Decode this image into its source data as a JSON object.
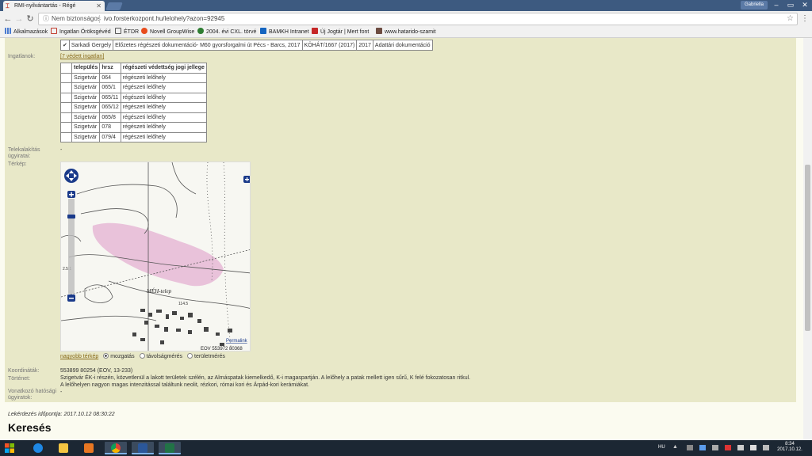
{
  "browser": {
    "tab_title": "RMI-nyilvántartás - Régé",
    "user_button": "Gabriella",
    "address_security": "Nem biztonságos",
    "address_url": "ivo.forsterkozpont.hu/lelohely?azon=92945",
    "bookmarks": [
      {
        "label": "Alkalmazások",
        "color": "#4a7bd0"
      },
      {
        "label": "Ingatlan Öröksgévéd",
        "color": "#c0392b"
      },
      {
        "label": "ÉTDR",
        "color": "#555555"
      },
      {
        "label": "Novell GroupWise",
        "color": "#e84c1c"
      },
      {
        "label": "2004. évi CXL. törvé",
        "color": "#2e7d32"
      },
      {
        "label": "BAMKH Intranet",
        "color": "#1565c0"
      },
      {
        "label": "Új Jogtár | Mert font",
        "color": "#c62828"
      },
      {
        "label": "www.hatarido-szamit",
        "color": "#6d4c41"
      }
    ]
  },
  "documents": {
    "row": [
      "Sarkadi Gergely",
      "Előzetes régészeti dokumentáció- M60 gyorsforgalmi út Pécs - Barcs, 2017",
      "KÖHÁT/1667 (2017)",
      "2017",
      "Adattári dokumentáció"
    ]
  },
  "ingatlanok": {
    "label": "Ingatlanok:",
    "link": "[7 védett ingatlan]",
    "headers": [
      "település",
      "hrsz",
      "régészeti védettség jogi jellege"
    ],
    "rows": [
      [
        "Szigetvár",
        "064",
        "régészeti lelőhely"
      ],
      [
        "Szigetvár",
        "065/1",
        "régészeti lelőhely"
      ],
      [
        "Szigetvár",
        "065/11",
        "régészeti lelőhely"
      ],
      [
        "Szigetvár",
        "065/12",
        "régészeti lelőhely"
      ],
      [
        "Szigetvár",
        "065/8",
        "régészeti lelőhely"
      ],
      [
        "Szigetvár",
        "078",
        "régészeti lelőhely"
      ],
      [
        "Szigetvár",
        "079/4",
        "régészeti lelőhely"
      ]
    ]
  },
  "telekalakitas": {
    "label": "Telekalakítás ügyiratai:",
    "value": "-"
  },
  "terkep": {
    "label": "Térkép:",
    "map_label_meh": "MÉH-telep",
    "permalink": "Permalink",
    "coords_overlay": "EOV 553972 80368",
    "map_numbers": [
      "2.5:1",
      "114.5"
    ],
    "larger_map": "nagyobb térkép",
    "options": [
      "mozgatás",
      "távolságmérés",
      "területmérés"
    ],
    "selected_option": "mozgatás"
  },
  "koordinatak": {
    "label": "Koordináták:",
    "value": "553899 80254 (EOV, 13-233)"
  },
  "tortenet": {
    "label": "Történet:",
    "line1": "Szigetvár ÉK-i részén, közvetlenül a lakott területek szélén, az Almáspatak kiemelkedő, K-i magaspartján. A lelőhely a patak mellett igen sűrű, K felé fokozatosan ritkul.",
    "line2": "A lelőhelyen nagyon magas intenzitással találtunk neolit, rézkori, római kori és Árpád-kori kerámiákat."
  },
  "vonatkozo": {
    "label": "Vonatkozó hatósági ügyiratok:",
    "value": "-"
  },
  "footer": {
    "lekerdezes": "Lekérdezés időpontja: 2017.10.12 08:30:22",
    "kereses": "Keresés"
  },
  "taskbar": {
    "lang": "HU",
    "time": "8:34",
    "date": "2017.10.12."
  },
  "colors": {
    "content_bg": "#e8e8c8",
    "page_bg": "#fbfbf0",
    "map_highlight": "#e6b8d6",
    "tabstrip": "#3d5a80",
    "taskbar": "#1c2733"
  }
}
